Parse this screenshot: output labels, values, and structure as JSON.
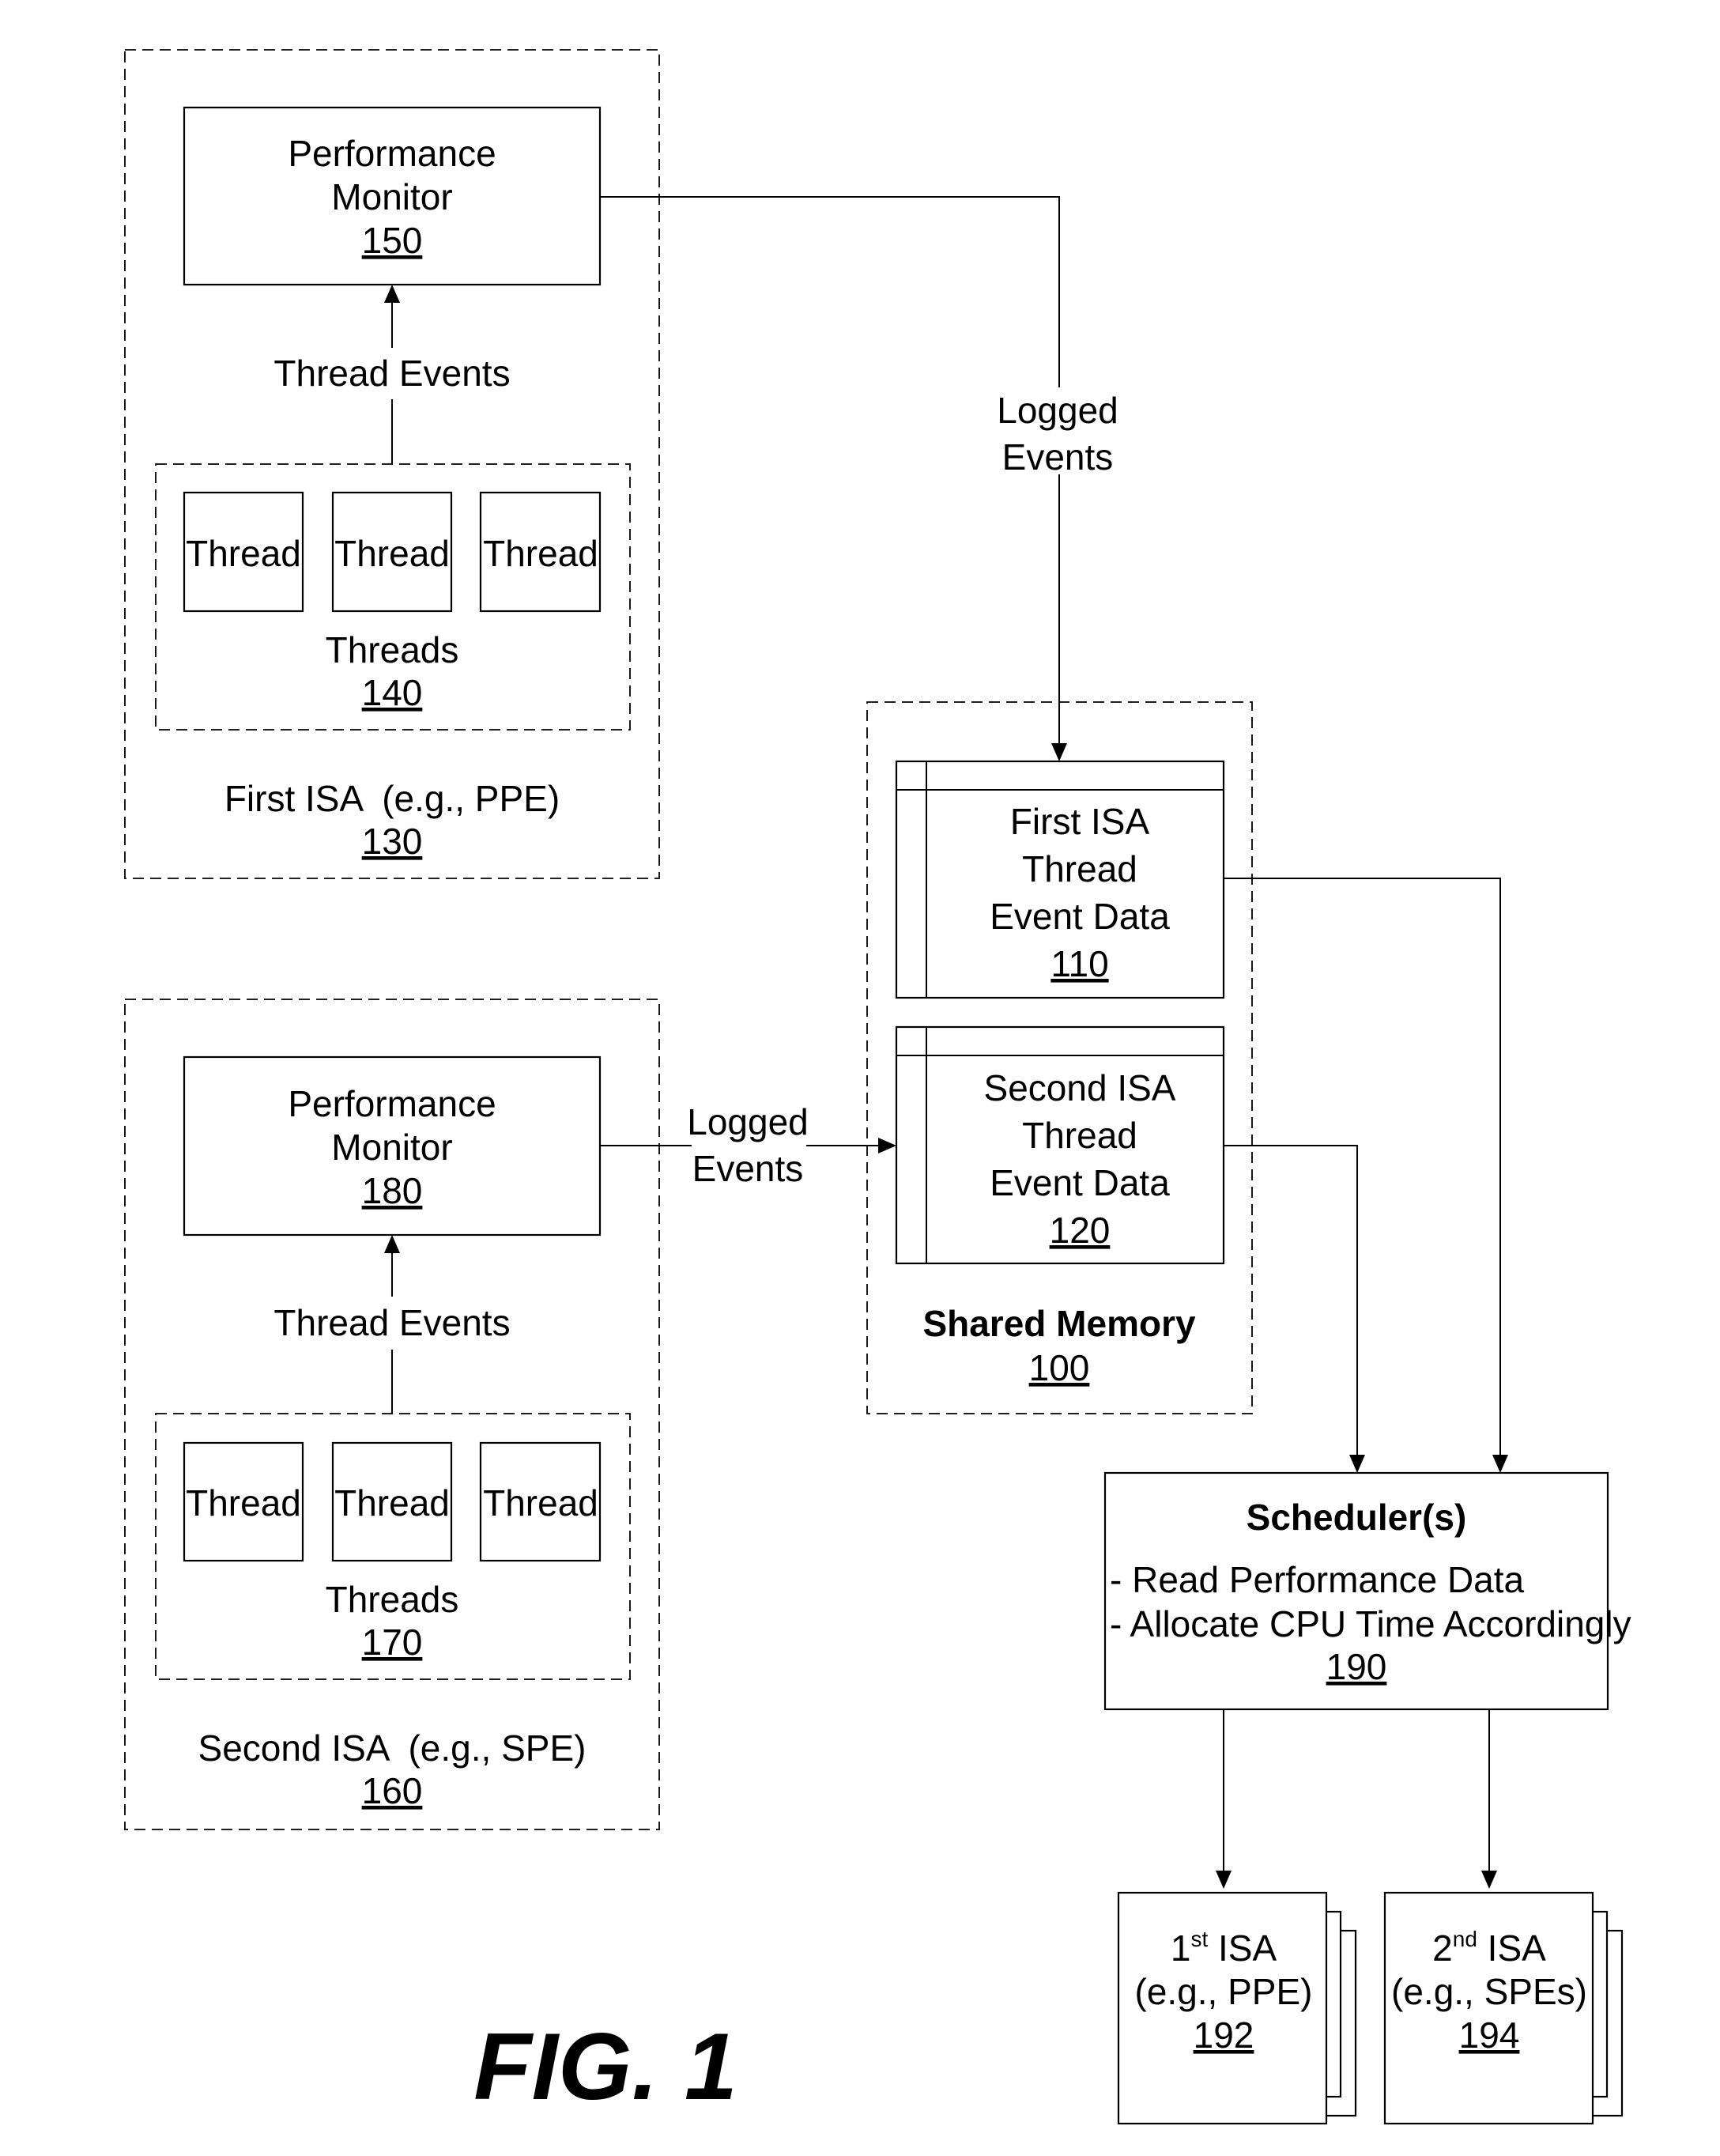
{
  "figure_label": "FIG. 1",
  "first_isa_group": {
    "title": "First ISA  (e.g., PPE)",
    "ref": "130",
    "performance_monitor": {
      "line1": "Performance",
      "line2": "Monitor",
      "ref": "150"
    },
    "thread_events_label": "Thread Events",
    "threads_group": {
      "label": "Threads",
      "ref": "140",
      "threads": [
        "Thread",
        "Thread",
        "Thread"
      ]
    }
  },
  "second_isa_group": {
    "title": "Second ISA  (e.g., SPE)",
    "ref": "160",
    "performance_monitor": {
      "line1": "Performance",
      "line2": "Monitor",
      "ref": "180"
    },
    "thread_events_label": "Thread Events",
    "threads_group": {
      "label": "Threads",
      "ref": "170",
      "threads": [
        "Thread",
        "Thread",
        "Thread"
      ]
    }
  },
  "logged_events_top": {
    "line1": "Logged",
    "line2": "Events"
  },
  "logged_events_mid": {
    "line1": "Logged",
    "line2": "Events"
  },
  "shared_memory": {
    "title": "Shared Memory",
    "ref": "100",
    "first_data": {
      "line1": "First ISA",
      "line2": "Thread",
      "line3": "Event Data",
      "ref": "110"
    },
    "second_data": {
      "line1": "Second ISA",
      "line2": "Thread",
      "line3": "Event Data",
      "ref": "120"
    }
  },
  "scheduler": {
    "title": "Scheduler(s)",
    "item1": "- Read Performance Data",
    "item2": "- Allocate CPU Time Accordingly",
    "ref": "190"
  },
  "isa_cards": [
    {
      "num": "1",
      "sup": "st",
      "suffix": " ISA",
      "example": "(e.g., PPE)",
      "ref": "192"
    },
    {
      "num": "2",
      "sup": "nd",
      "suffix": " ISA",
      "example": "(e.g., SPEs)",
      "ref": "194"
    }
  ]
}
